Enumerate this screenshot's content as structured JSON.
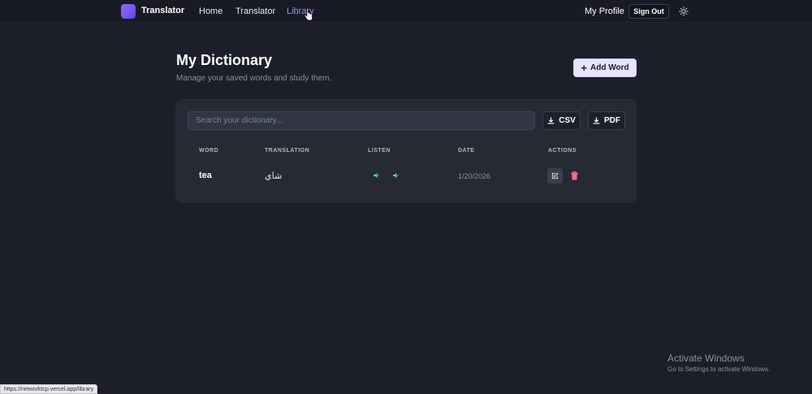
{
  "nav": {
    "brand": "Translator",
    "links": [
      {
        "label": "Home"
      },
      {
        "label": "Translator"
      },
      {
        "label": "Library"
      }
    ],
    "profile": "My Profile",
    "sign_out": "Sign Out",
    "accent": "#9b8cff"
  },
  "header": {
    "title": "My Dictionary",
    "subtitle": "Manage your saved words and study them.",
    "add_word": "Add Word"
  },
  "toolbar": {
    "search_placeholder": "Search your dictionary...",
    "csv_label": "CSV",
    "pdf_label": "PDF"
  },
  "table": {
    "columns": [
      "WORD",
      "TRANSLATION",
      "LISTEN",
      "DATE",
      "ACTIONS"
    ],
    "rows": [
      {
        "word": "tea",
        "translation": "شاي",
        "date": "1/20/2026"
      }
    ]
  },
  "watermark": {
    "title": "Activate Windows",
    "subtitle": "Go to Settings to activate Windows."
  },
  "status_bar": {
    "url": "https://networktcp.vercel.app/library"
  },
  "icons": [
    "logo-icon",
    "cursor-icon",
    "sun-icon",
    "plus-icon",
    "download-icon",
    "speaker-icon",
    "edit-icon",
    "trash-icon"
  ]
}
